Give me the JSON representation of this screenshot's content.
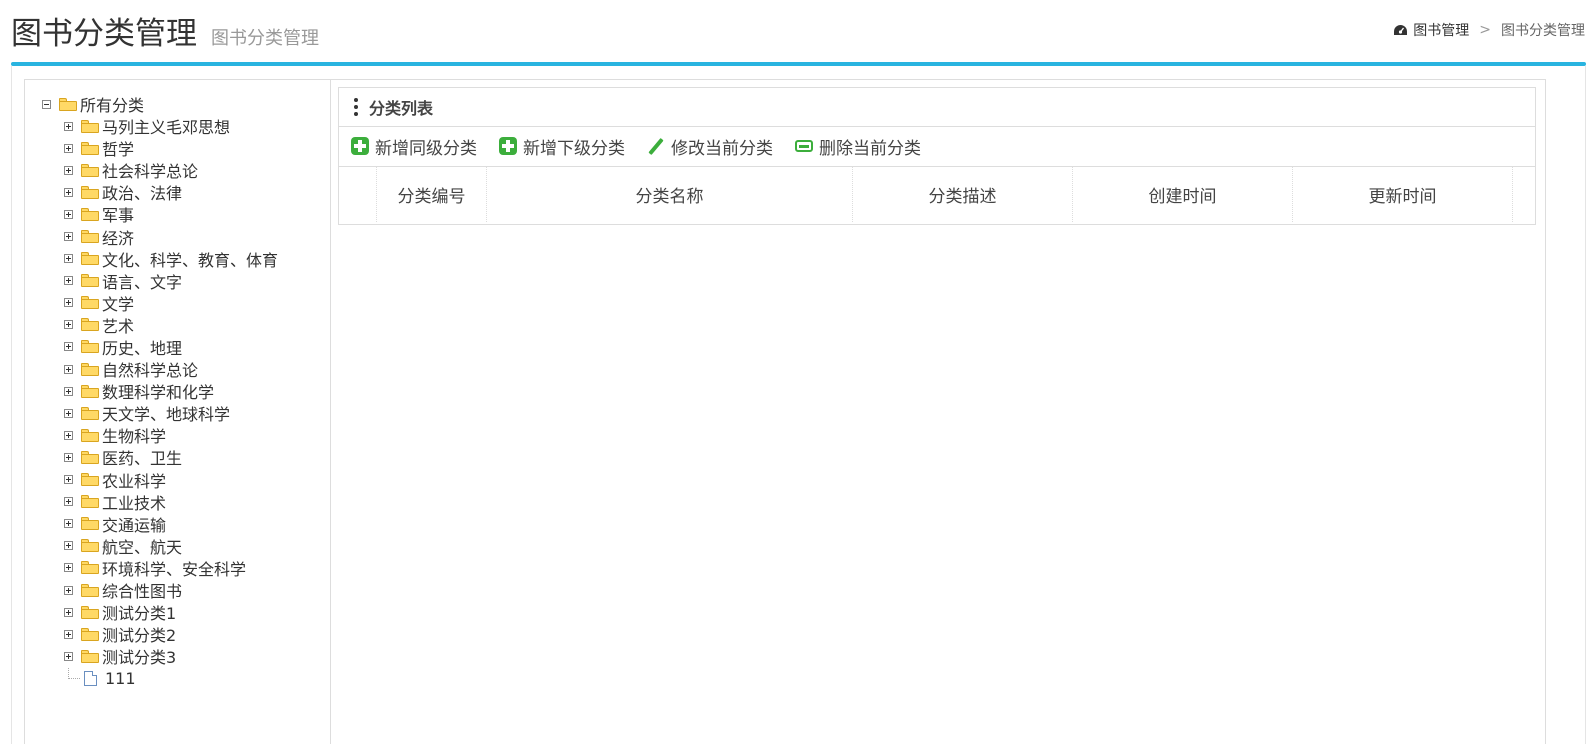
{
  "header": {
    "title": "图书分类管理",
    "subtitle": "图书分类管理",
    "breadcrumb": {
      "home": "图书管理",
      "separator": ">",
      "current": "图书分类管理"
    }
  },
  "tree": {
    "root_label": "所有分类",
    "items": [
      "马列主义毛邓思想",
      "哲学",
      "社会科学总论",
      "政治、法律",
      "军事",
      "经济",
      "文化、科学、教育、体育",
      "语言、文字",
      "文学",
      "艺术",
      "历史、地理",
      "自然科学总论",
      "数理科学和化学",
      "天文学、地球科学",
      "生物科学",
      "医药、卫生",
      "农业科学",
      "工业技术",
      "交通运输",
      "航空、航天",
      "环境科学、安全科学",
      "综合性图书",
      "测试分类1",
      "测试分类2",
      "测试分类3"
    ],
    "leaf_label": "111"
  },
  "panel": {
    "title": "分类列表",
    "toolbar": {
      "add_sibling": "新增同级分类",
      "add_child": "新增下级分类",
      "edit": "修改当前分类",
      "delete": "删除当前分类"
    },
    "columns": {
      "id": "分类编号",
      "name": "分类名称",
      "desc": "分类描述",
      "created": "创建时间",
      "updated": "更新时间"
    }
  },
  "colors": {
    "accent_line": "#29b4e0",
    "icon_green": "#3cae3c",
    "folder": "#ffd966"
  }
}
